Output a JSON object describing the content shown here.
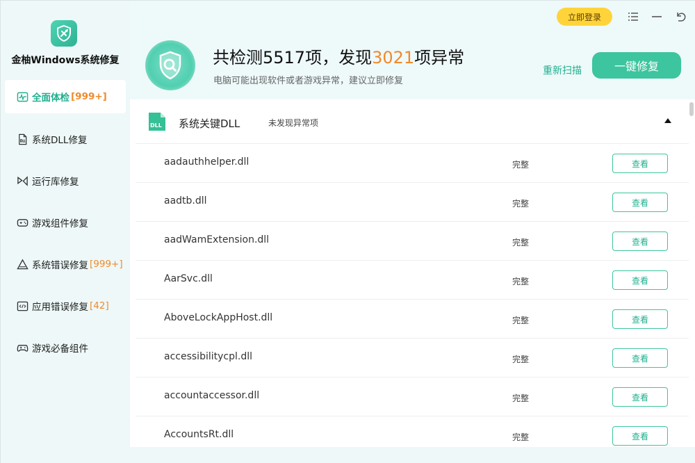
{
  "app": {
    "title": "金柚Windows系统修复"
  },
  "sidebar": {
    "items": [
      {
        "label": "全面体检",
        "badge": "[999+]",
        "icon": "pulse-icon",
        "active": true
      },
      {
        "label": "系统DLL修复",
        "badge": "",
        "icon": "dll-file-icon",
        "active": false
      },
      {
        "label": "运行库修复",
        "badge": "",
        "icon": "runtime-icon",
        "active": false
      },
      {
        "label": "游戏组件修复",
        "badge": "",
        "icon": "gamepad-icon",
        "active": false
      },
      {
        "label": "系统错误修复",
        "badge": "[999+]",
        "icon": "warning-icon",
        "active": false
      },
      {
        "label": "应用错误修复",
        "badge": "[42]",
        "icon": "code-window-icon",
        "active": false
      },
      {
        "label": "游戏必备组件",
        "badge": "",
        "icon": "controller-icon",
        "active": false
      }
    ]
  },
  "header": {
    "login_label": "立即登录",
    "scan_prefix": "共检测",
    "scan_total": "5517",
    "scan_middle": "项，发现",
    "scan_found": "3021",
    "scan_suffix": "项异常",
    "subtitle": "电脑可能出现软件或者游戏异常，建议立即修复",
    "rescan_label": "重新扫描",
    "fix_label": "一键修复"
  },
  "section": {
    "icon_text": "DLL",
    "title": "系统关键DLL",
    "status": "未发现异常项"
  },
  "rows": [
    {
      "name": "aadauthhelper.dll",
      "status": "完整",
      "action": "查看"
    },
    {
      "name": "aadtb.dll",
      "status": "完整",
      "action": "查看"
    },
    {
      "name": "aadWamExtension.dll",
      "status": "完整",
      "action": "查看"
    },
    {
      "name": "AarSvc.dll",
      "status": "完整",
      "action": "查看"
    },
    {
      "name": "AboveLockAppHost.dll",
      "status": "完整",
      "action": "查看"
    },
    {
      "name": "accessibilitycpl.dll",
      "status": "完整",
      "action": "查看"
    },
    {
      "name": "accountaccessor.dll",
      "status": "完整",
      "action": "查看"
    },
    {
      "name": "AccountsRt.dll",
      "status": "完整",
      "action": "查看"
    }
  ],
  "colors": {
    "accent": "#21b08f",
    "button_green": "#3cc59e",
    "warning_orange": "#f08a2a",
    "login_yellow": "#ffd43b",
    "sidebar_bg": "#eef8f8"
  }
}
